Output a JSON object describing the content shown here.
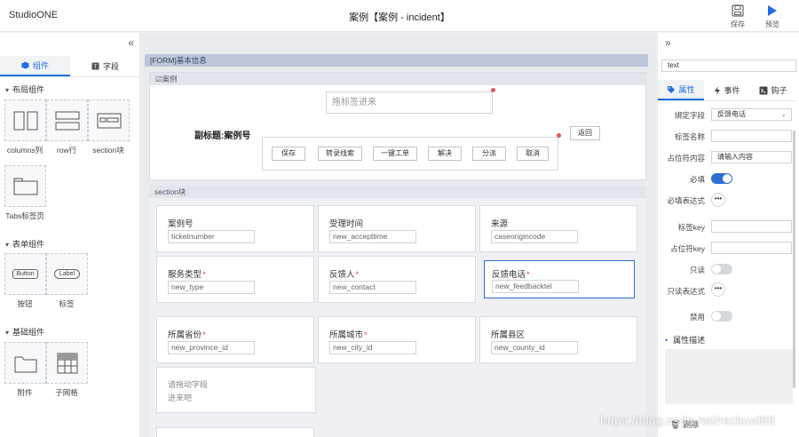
{
  "app": {
    "name": "StudioONE",
    "title": "案例【案例 - incident】"
  },
  "toolbar": {
    "save_label": "保存",
    "preview_label": "预览"
  },
  "left_panel": {
    "tabs": [
      {
        "label": "组件",
        "active": true
      },
      {
        "label": "字段",
        "active": false
      }
    ],
    "groups": {
      "layout": {
        "title": "布局组件",
        "items": [
          "columns列",
          "row行",
          "section块",
          "Tabs标签页"
        ]
      },
      "form": {
        "title": "表单组件",
        "items": [
          "按钮",
          "标签"
        ],
        "icon_texts": [
          "Button",
          "Label"
        ]
      },
      "basic": {
        "title": "基础组件",
        "items": [
          "附件",
          "子网格"
        ]
      }
    }
  },
  "canvas": {
    "form_header": "[FORM]基本信息",
    "case_section": {
      "header": "☑案例",
      "drop_tag_placeholder": "拖标签进来",
      "subtitle": "副标题:案例号",
      "buttons": [
        "保存",
        "转录线索",
        "一键工单",
        "解决",
        "分派",
        "取消"
      ],
      "back_button": "返回"
    },
    "section_block": {
      "header": "section块",
      "fields": [
        {
          "label": "案例号",
          "required": false,
          "value": "ticketnumber"
        },
        {
          "label": "受理时间",
          "required": false,
          "value": "new_accepttime"
        },
        {
          "label": "来源",
          "required": false,
          "value": "caseorigincode"
        },
        {
          "label": "服务类型",
          "required": true,
          "value": "new_type"
        },
        {
          "label": "反馈人",
          "required": true,
          "value": "new_contact"
        },
        {
          "label": "反馈电话",
          "required": true,
          "value": "new_feedbacktel",
          "selected": true
        },
        {
          "label": "所属省份",
          "required": true,
          "value": "new_province_id"
        },
        {
          "label": "所属城市",
          "required": true,
          "value": "new_city_id"
        },
        {
          "label": "所属县区",
          "required": false,
          "value": "new_county_id"
        }
      ],
      "drop_placeholder_line1": "请拖动字段",
      "drop_placeholder_line2": "进来吧"
    }
  },
  "right_panel": {
    "type_value": "text",
    "tabs": [
      {
        "label": "属性",
        "active": true
      },
      {
        "label": "事件",
        "active": false
      },
      {
        "label": "钩子",
        "active": false
      }
    ],
    "props": {
      "bind_field_label": "绑定字段",
      "bind_field_value": "反馈电话",
      "tag_name_label": "标签名称",
      "tag_name_value": "",
      "placeholder_content_label": "占位符内容",
      "placeholder_content_value": "请输入内容",
      "required_label": "必填",
      "required_on": true,
      "required_expr_label": "必填表达式",
      "tag_key_label": "标签key",
      "placeholder_key_label": "占位符key",
      "readonly_label": "只读",
      "readonly_on": false,
      "readonly_expr_label": "只读表达式",
      "disabled_label": "禁用",
      "disabled_on": false,
      "dots": "•••"
    },
    "desc_title": "属性描述",
    "delete_label": "删除"
  },
  "watermark": "https://blog.csdn.net/recloud88"
}
